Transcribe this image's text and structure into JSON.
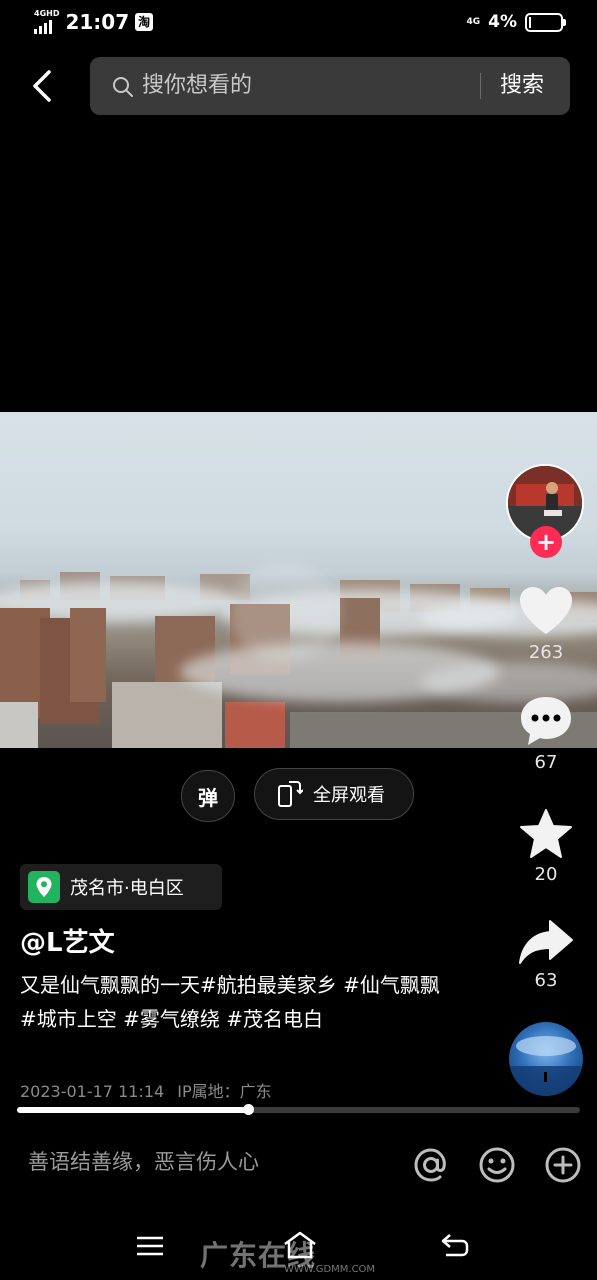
{
  "status_bar": {
    "network_label": "4GHD",
    "time": "21:07",
    "app_badge": "淘",
    "net_type": "4G",
    "battery": "4%"
  },
  "search": {
    "placeholder": "搜你想看的",
    "button_label": "搜索"
  },
  "player_controls": {
    "danmu_label": "弹",
    "fullscreen_label": "全屏观看"
  },
  "post": {
    "location": "茂名市·电白区",
    "author": "@L艺文",
    "caption": "又是仙气飘飘的一天#航拍最美家乡 #仙气飘飘 #城市上空 #雾气缭绕 #茂名电白",
    "timestamp": "2023-01-17 11:14",
    "ip_location": "IP属地：广东",
    "progress_fraction": 0.41
  },
  "actions": {
    "likes": "263",
    "comments": "67",
    "favorites": "20",
    "shares": "63",
    "follow_symbol": "+"
  },
  "comment_bar": {
    "placeholder": "善语结善缘，恶言伤人心"
  },
  "watermark": {
    "text": "广东在线",
    "url": "WWW.GDMM.COM"
  },
  "colors": {
    "accent_red": "#fe2c55",
    "location_green": "#22b35e",
    "search_bg": "#3a3a3a"
  }
}
